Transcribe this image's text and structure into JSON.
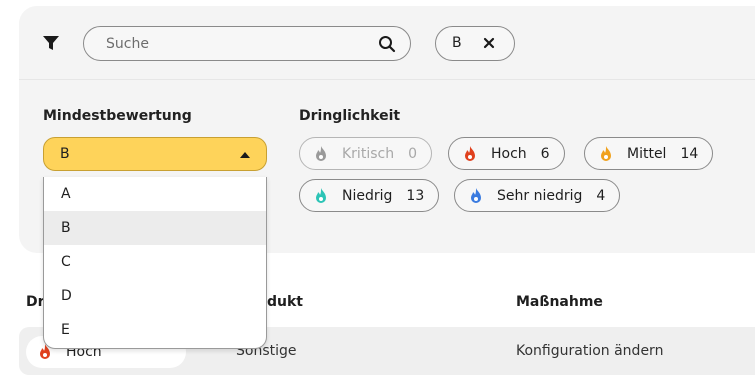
{
  "search": {
    "placeholder": "Suche"
  },
  "active_filter": {
    "label": "B"
  },
  "min_rating": {
    "title": "Mindestbewertung",
    "selected": "B",
    "options": [
      "A",
      "B",
      "C",
      "D",
      "E"
    ]
  },
  "urgency": {
    "title": "Dringlichkeit",
    "items": [
      {
        "label": "Kritisch",
        "count": "0",
        "color": "#9a9a9a",
        "icon": "flame-icon",
        "disabled": true
      },
      {
        "label": "Hoch",
        "count": "6",
        "color": "#e0411e",
        "icon": "flame-icon"
      },
      {
        "label": "Mittel",
        "count": "14",
        "color": "#f0a11c",
        "icon": "flame-icon"
      },
      {
        "label": "Niedrig",
        "count": "13",
        "color": "#2cc4b6",
        "icon": "flame-icon"
      },
      {
        "label": "Sehr niedrig",
        "count": "4",
        "color": "#3a7be0",
        "icon": "flame-icon"
      }
    ]
  },
  "table": {
    "headers": {
      "urgency": "Dr",
      "product": "dukt",
      "action": "Maßnahme"
    },
    "rows": [
      {
        "urgency": "Hoch",
        "urgency_color": "#e0411e",
        "product": "Sonstige",
        "action": "Konfiguration ändern"
      }
    ]
  }
}
